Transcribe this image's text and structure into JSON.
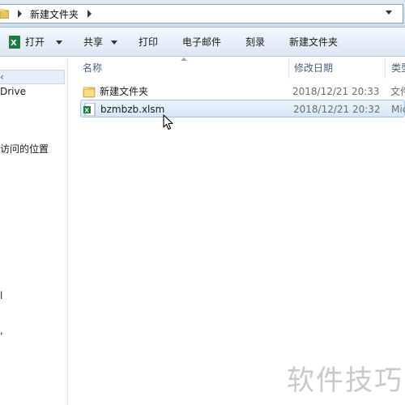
{
  "addressbar": {
    "crumb": "新建文件夹"
  },
  "toolbar": {
    "open_label": "打开",
    "share_label": "共享",
    "print_label": "打印",
    "email_label": "电子邮件",
    "burn_label": "刻录",
    "new_folder_label": "新建文件夹"
  },
  "navpane": {
    "items": [
      {
        "label": "‹"
      },
      {
        "label": "Drive"
      },
      {
        "label": "访问的位置"
      },
      {
        "label": "l"
      },
      {
        "label": ","
      }
    ]
  },
  "columns": {
    "name": "名称",
    "date": "修改日期",
    "type": "类型"
  },
  "files": [
    {
      "name": "新建文件夹",
      "date": "2018/12/21 20:33",
      "type": "文件",
      "icon": "folder-icon"
    },
    {
      "name": "bzmbzb.xlsm",
      "date": "2018/12/21 20:32",
      "type": "Mic",
      "icon": "excel-file-icon"
    }
  ],
  "watermark": {
    "text": "软件技巧"
  },
  "colors": {
    "selection": "#d7e7f8",
    "excel_green": "#1e7a43",
    "folder_yellow": "#e8c25a"
  }
}
